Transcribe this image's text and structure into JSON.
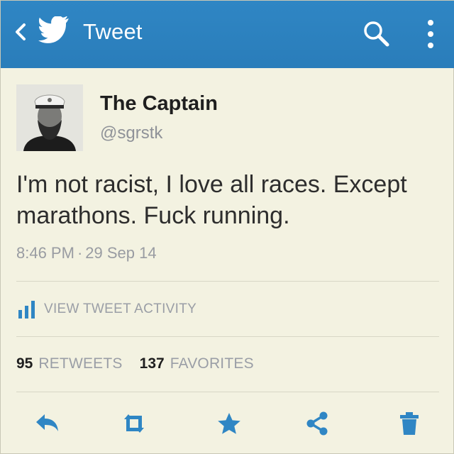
{
  "header": {
    "title": "Tweet",
    "icons": [
      "back-arrow-icon",
      "twitter-bird-icon",
      "search-icon",
      "overflow-menu-icon"
    ],
    "background": "#2f86c4"
  },
  "tweet": {
    "author_name": "The Captain",
    "author_handle": "@sgrstk",
    "text": "I'm not racist, I love all races. Except marathons. Fuck running.",
    "time": "8:46 PM",
    "separator": "·",
    "date": "29 Sep 14"
  },
  "activity": {
    "label": "VIEW TWEET ACTIVITY",
    "icon": "bar-chart-icon",
    "accent": "#2f86c4"
  },
  "stats": {
    "retweets_count": "95",
    "retweets_label": "RETWEETS",
    "favorites_count": "137",
    "favorites_label": "FAVORITES"
  },
  "actions": {
    "icons": [
      "reply-icon",
      "retweet-icon",
      "favorite-star-icon",
      "share-icon",
      "delete-trash-icon"
    ],
    "color": "#2f86c4"
  }
}
